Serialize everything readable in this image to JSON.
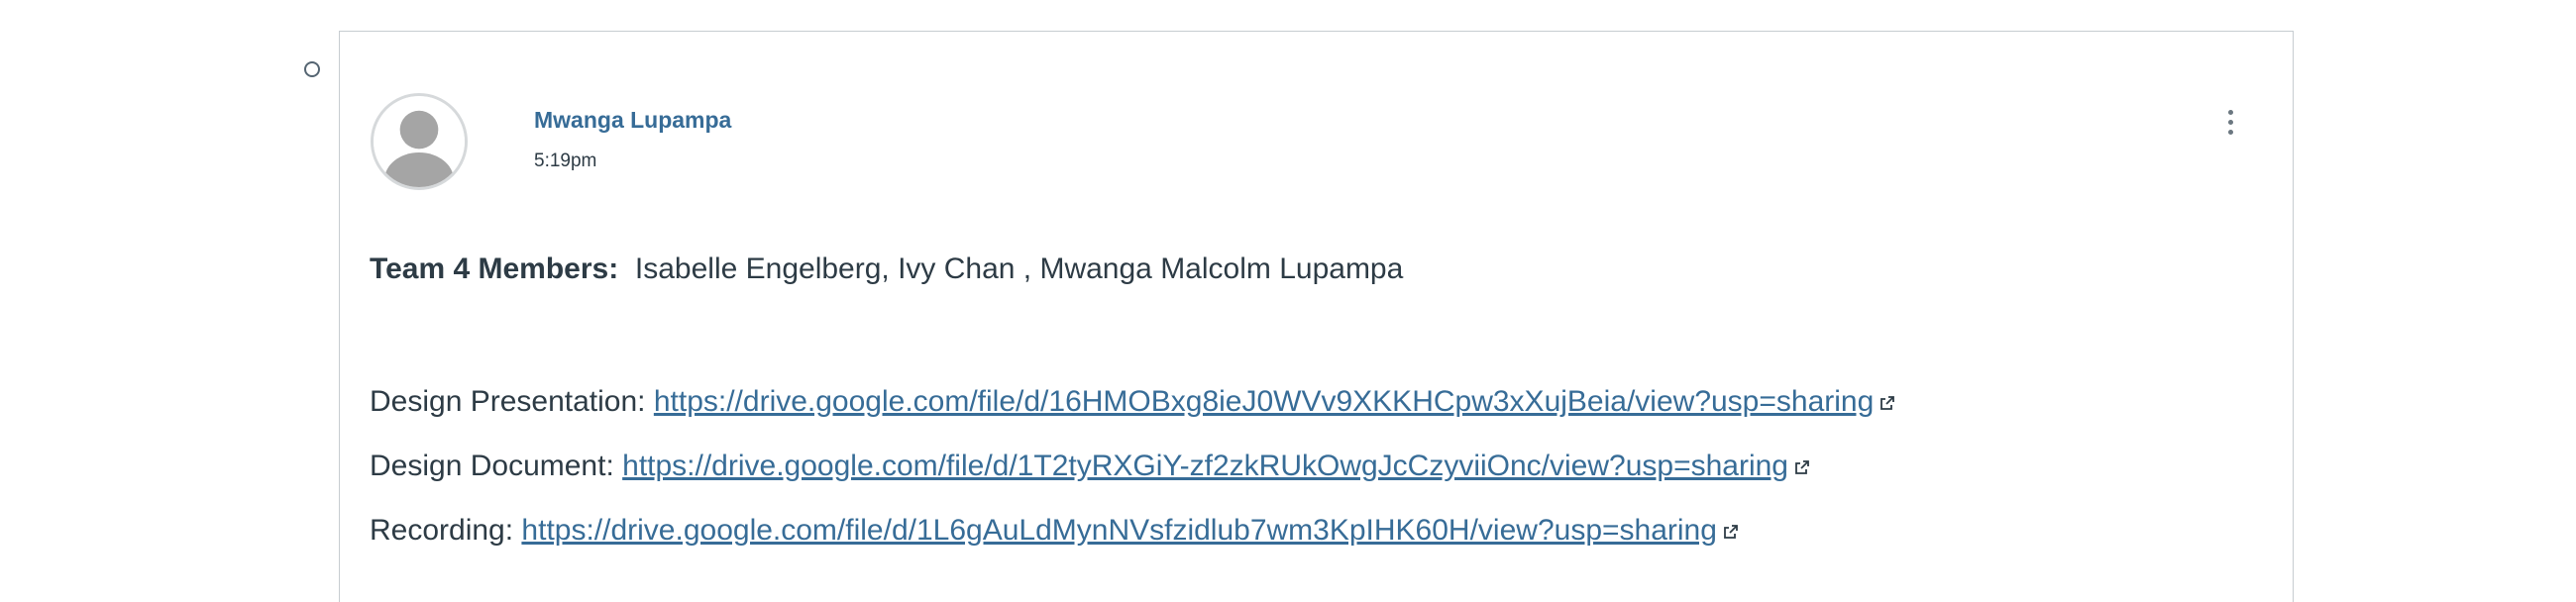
{
  "post": {
    "author": "Mwanga Lupampa",
    "timestamp": "5:19pm",
    "team_label": "Team 4 Members:",
    "team_members": "Isabelle Engelberg, Ivy Chan , Mwanga Malcolm Lupampa",
    "links": [
      {
        "label": "Design Presentation:",
        "url": "https://drive.google.com/file/d/16HMOBxg8ieJ0WVv9XKKHCpw3xXujBeia/view?usp=sharing"
      },
      {
        "label": "Design Document:",
        "url": "https://drive.google.com/file/d/1T2tyRXGiY-zf2zkRUkOwgJcCzyviiOnc/view?usp=sharing"
      },
      {
        "label": "Recording:",
        "url": "https://drive.google.com/file/d/1L6gAuLdMynNVsfzidlub7wm3KpIHK60H/view?usp=sharing"
      }
    ]
  },
  "colors": {
    "link": "#376c97",
    "text": "#2d3b45",
    "border": "#c7cdd1"
  },
  "icons": {
    "unread": "unread-indicator-icon",
    "options": "kebab-menu-icon",
    "external_link": "external-link-icon",
    "avatar": "default-avatar-icon"
  }
}
